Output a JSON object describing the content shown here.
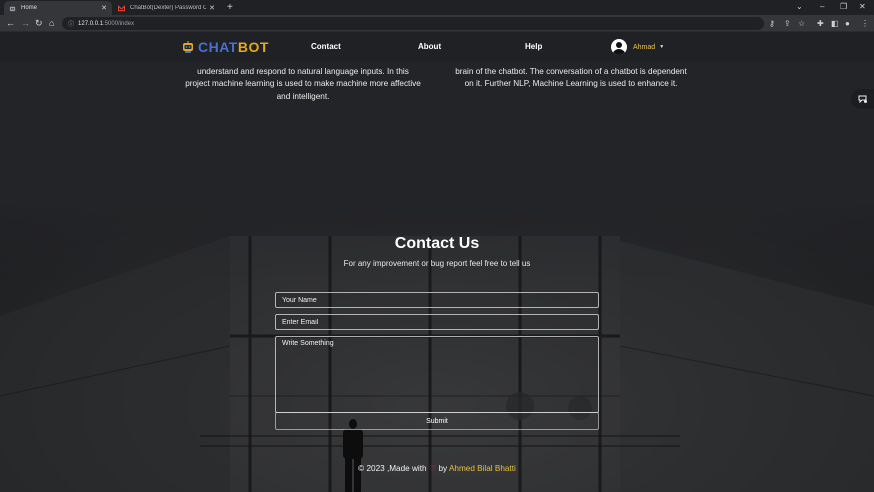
{
  "browser": {
    "tabs": [
      {
        "title": "Home",
        "active": true
      },
      {
        "title": "ChatBot(Dexter) Password Chang",
        "active": false
      }
    ],
    "url_host": "127.0.0.1",
    "url_path": ":5000/index"
  },
  "navbar": {
    "brand_part1": "CHAT",
    "brand_part2": "BOT",
    "links": [
      "Contact",
      "About",
      "Help"
    ],
    "user_name": "Ahmad"
  },
  "about": {
    "left_text": "understand and respond to natural language inputs. In this project machine learning is used to make machine more affective and intelligent.",
    "right_text": "brain of the chatbot. The conversation of a chatbot is dependent on it. Further NLP, Machine Learning is used to enhance it."
  },
  "contact": {
    "title": "Contact Us",
    "subtitle": "For any improvement or bug report feel free to tell us",
    "name_placeholder": "Your Name",
    "email_placeholder": "Enter Email",
    "message_placeholder": "Write Something",
    "submit_label": "Submit"
  },
  "footer": {
    "prefix": "© 2023 ,Made with",
    "heart": "♡",
    "by": "by",
    "author": "Ahmed Bilal Bhatti"
  },
  "colors": {
    "brand_blue": "#4a6fd1",
    "brand_orange": "#e4a923",
    "author_gold": "#e6c23a",
    "heart_red": "#d9363e"
  }
}
